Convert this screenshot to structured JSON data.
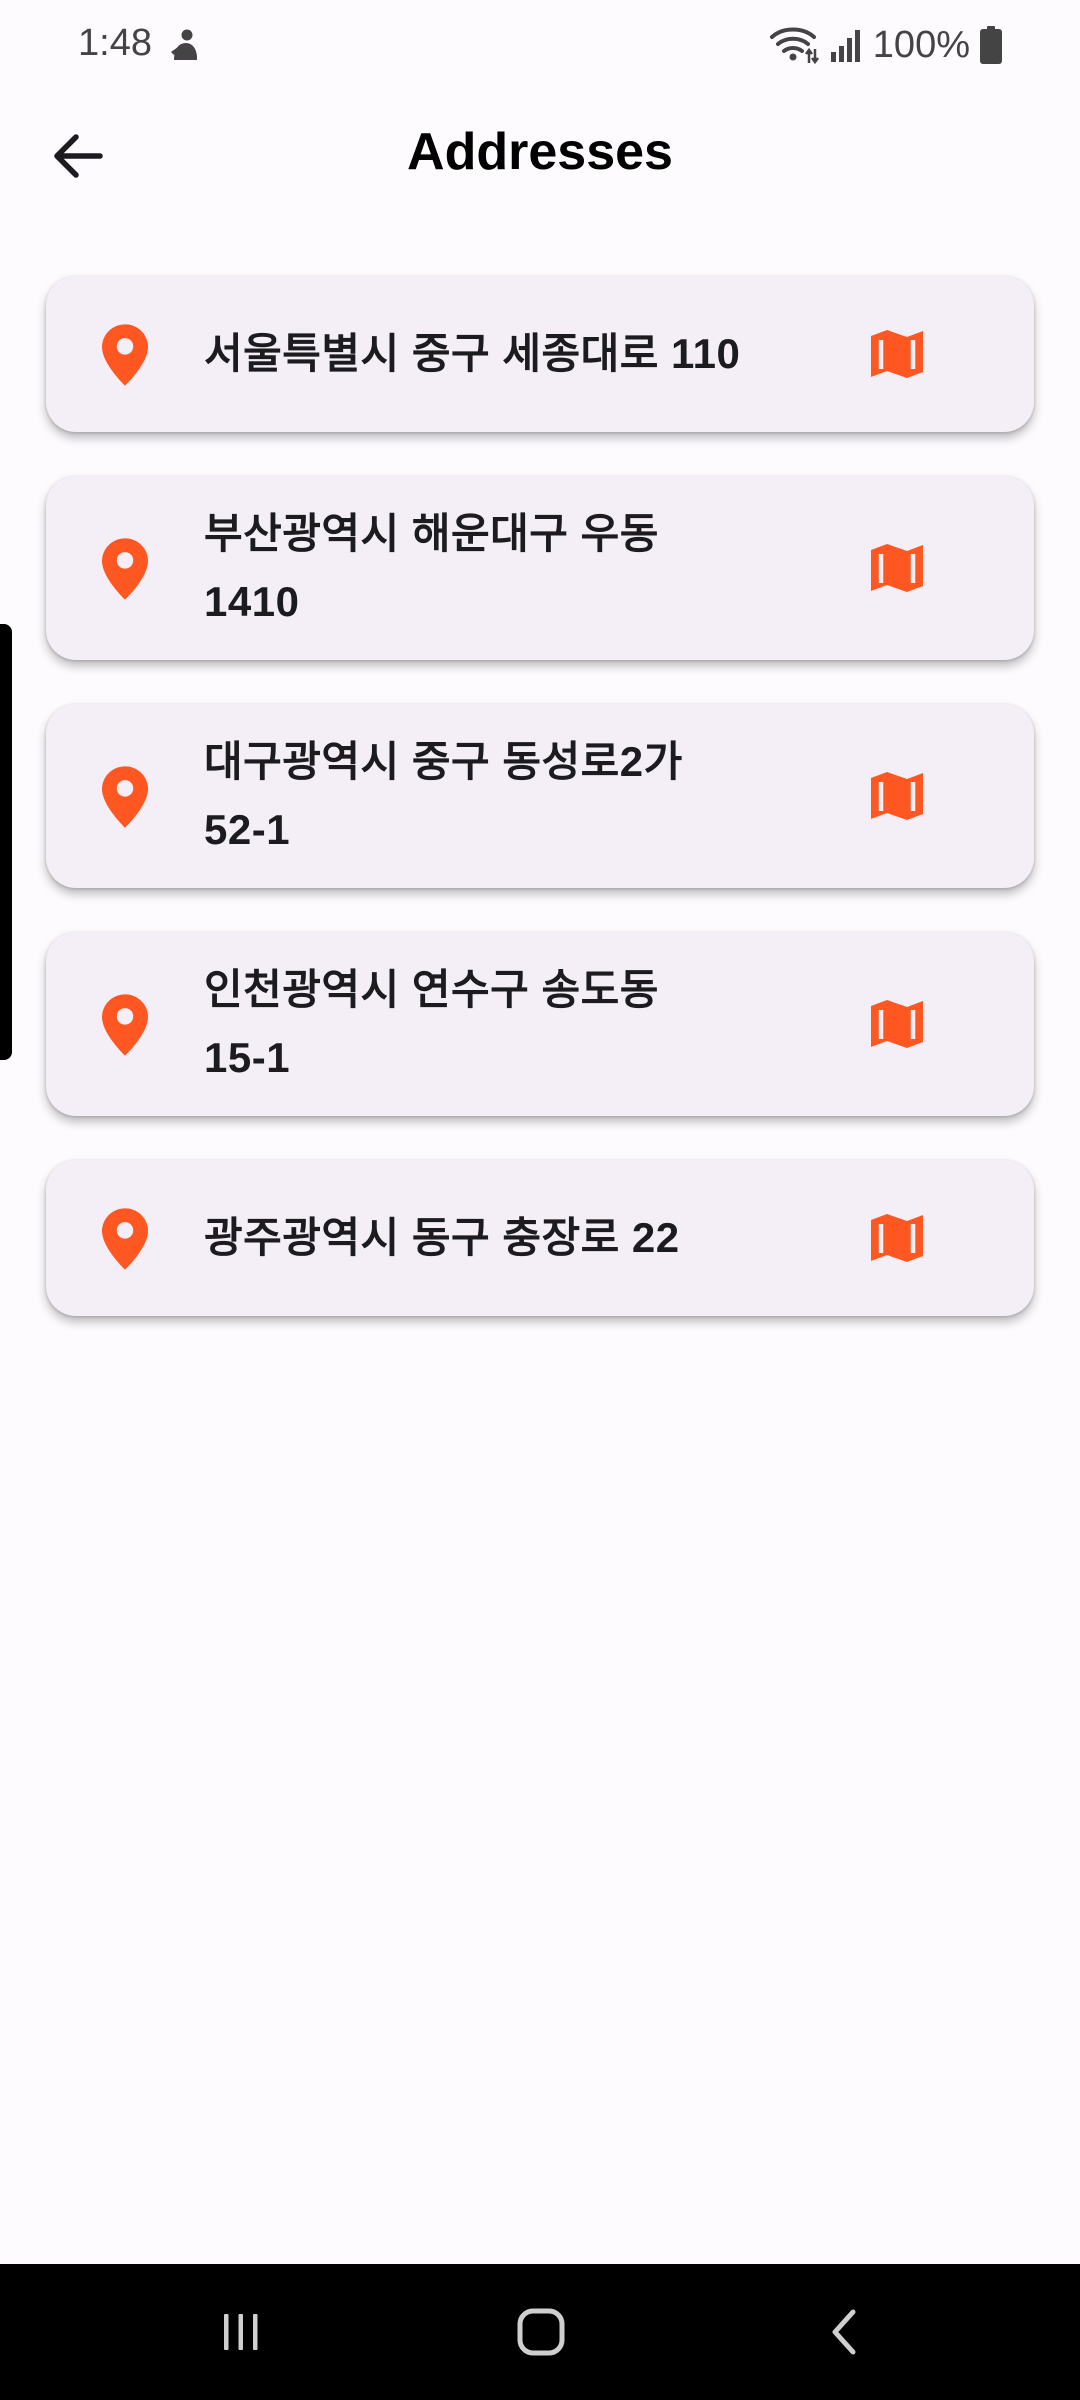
{
  "status_bar": {
    "time": "1:48",
    "battery": "100%",
    "icons": [
      "person-icon",
      "wifi-icon",
      "signal-icon",
      "battery-icon"
    ]
  },
  "app_bar": {
    "title": "Addresses",
    "back_icon": "back-arrow-icon"
  },
  "addresses": [
    {
      "text": "서울특별시 중구 세종대로 110",
      "icon": "location-pin-icon",
      "action_icon": "map-icon"
    },
    {
      "text": "부산광역시 해운대구 우동 1410",
      "icon": "location-pin-icon",
      "action_icon": "map-icon"
    },
    {
      "text": "대구광역시 중구 동성로2가 52-1",
      "icon": "location-pin-icon",
      "action_icon": "map-icon"
    },
    {
      "text": "인천광역시 연수구 송도동 15-1",
      "icon": "location-pin-icon",
      "action_icon": "map-icon"
    },
    {
      "text": "광주광역시 동구 충장로 22",
      "icon": "location-pin-icon",
      "action_icon": "map-icon"
    }
  ],
  "nav_bar": {
    "icons": [
      "recents-icon",
      "home-icon",
      "back-icon"
    ]
  },
  "colors": {
    "accent": "#ff5722",
    "card_background": "#f4eff7",
    "page_background": "#fefbff",
    "text": "#1c1b1f"
  }
}
